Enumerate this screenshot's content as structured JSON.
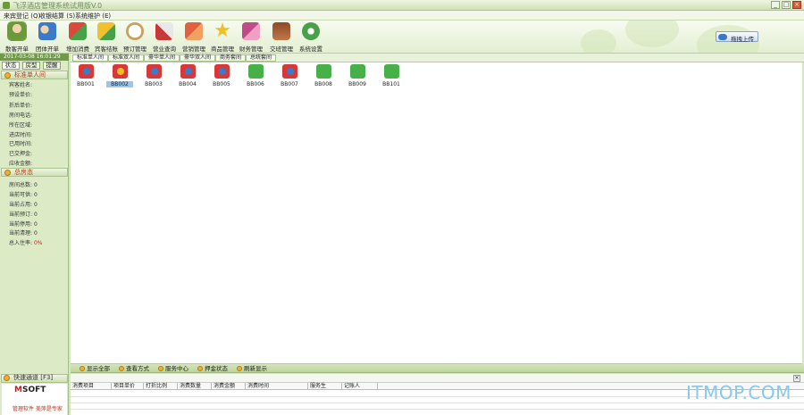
{
  "titlebar": {
    "title": "飞浮酒店管理系统试用版V.0",
    "minimize": "_",
    "maximize": "□",
    "close": "×"
  },
  "menubar": {
    "items": [
      "来宾登记 (Q)",
      "收银结算 (S)",
      "系统维护 (E)"
    ]
  },
  "toolbar": {
    "items": [
      {
        "label": "散客开单",
        "icon": "guest-person-icon",
        "color": "#6a9a3a"
      },
      {
        "label": "团体开单",
        "icon": "group-people-icon",
        "color": "#3a7ac8"
      },
      {
        "label": "增加消费",
        "icon": "add-consumption-arrow-icon",
        "color": "#d84a3a"
      },
      {
        "label": "宾客结账",
        "icon": "checkout-icon",
        "color": "#e8a020"
      },
      {
        "label": "预订管理",
        "icon": "clock-icon",
        "color": "#c8a060"
      },
      {
        "label": "营业查询",
        "icon": "business-query-icon",
        "color": "#c83838"
      },
      {
        "label": "营销管理",
        "icon": "marketing-icon",
        "color": "#e06040"
      },
      {
        "label": "商品管理",
        "icon": "star-icon",
        "color": "#f0c020"
      },
      {
        "label": "财务管理",
        "icon": "finance-icon",
        "color": "#c04a8a"
      },
      {
        "label": "交班管理",
        "icon": "shift-handover-icon",
        "color": "#8a4a28"
      },
      {
        "label": "系统设置",
        "icon": "gear-icon",
        "color": "#48a048"
      }
    ],
    "upload_button": "拖拽上传"
  },
  "sidebar": {
    "datetime": "2017-03-08 16:01:29",
    "tabs": [
      "状态",
      "房型",
      "提醒"
    ],
    "room_type_header": "标准单人间",
    "room_fields": [
      "宾客姓名:",
      "预设单价:",
      "折后单价:",
      "房间电话:",
      "所在区域:",
      "进店时间:",
      "已用时间:",
      "已交押金:",
      "应收金额:"
    ],
    "status_header": "总房态",
    "status_fields": [
      {
        "label": "房间总数:",
        "value": "0"
      },
      {
        "label": "当前可供:",
        "value": "0"
      },
      {
        "label": "当前占用:",
        "value": "0"
      },
      {
        "label": "当前预订:",
        "value": "0"
      },
      {
        "label": "当前停用:",
        "value": "0"
      },
      {
        "label": "当前清理:",
        "value": "0"
      },
      {
        "label": "总入住率:",
        "value": "0%"
      }
    ],
    "quick_channel": "快速通道 [F3]",
    "logo_brand_a": "M",
    "logo_brand_b": "SOFT",
    "logo_slogan": "管理软件 美萍是专家"
  },
  "room_tabs": [
    "标准单人间",
    "标准双人间",
    "豪华单人间",
    "豪华双人间",
    "商务套间",
    "总统套间"
  ],
  "rooms": [
    {
      "number": "BB001",
      "status": "occupied",
      "color": "#d83838",
      "selected": false
    },
    {
      "number": "BB002",
      "status": "out-of-service",
      "color": "#d83838",
      "selected": true
    },
    {
      "number": "BB003",
      "status": "occupied",
      "color": "#d83838",
      "selected": false
    },
    {
      "number": "BB004",
      "status": "occupied",
      "color": "#d83838",
      "selected": false
    },
    {
      "number": "BB005",
      "status": "occupied",
      "color": "#d83838",
      "selected": false
    },
    {
      "number": "BB006",
      "status": "available",
      "color": "#48b048",
      "selected": false
    },
    {
      "number": "BB007",
      "status": "occupied",
      "color": "#d83838",
      "selected": false
    },
    {
      "number": "BB008",
      "status": "available",
      "color": "#48b048",
      "selected": false
    },
    {
      "number": "BB009",
      "status": "available",
      "color": "#48b048",
      "selected": false
    },
    {
      "number": "BB101",
      "status": "available",
      "color": "#48b048",
      "selected": false
    }
  ],
  "actions": [
    "显示全部",
    "查看方式",
    "服务中心",
    "押金状态",
    "刷新显示"
  ],
  "ledger": {
    "columns": [
      "消费项目",
      "项目单价",
      "打折比例",
      "消费数量",
      "消费金额",
      "消费时间",
      "服务生",
      "记账人"
    ]
  },
  "watermark": "ITMOP.COM"
}
